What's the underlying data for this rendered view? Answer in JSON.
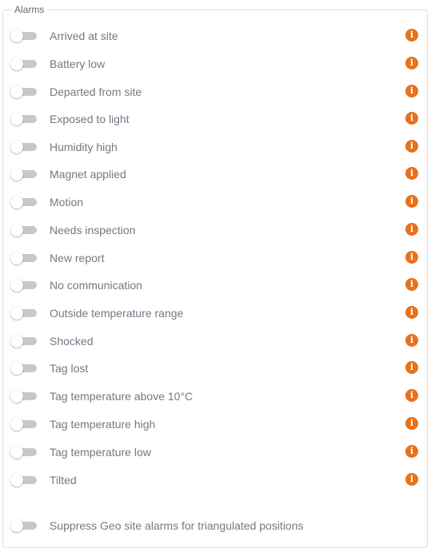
{
  "alarms": {
    "legend": "Alarms",
    "accent_color": "#e8711c",
    "toggle_state_default": "off",
    "info_icon": "info-circle-icon",
    "items": [
      {
        "label": "Arrived at site",
        "enabled": false
      },
      {
        "label": "Battery low",
        "enabled": false
      },
      {
        "label": "Departed from site",
        "enabled": false
      },
      {
        "label": "Exposed to light",
        "enabled": false
      },
      {
        "label": "Humidity high",
        "enabled": false
      },
      {
        "label": "Magnet applied",
        "enabled": false
      },
      {
        "label": "Motion",
        "enabled": false
      },
      {
        "label": "Needs inspection",
        "enabled": false
      },
      {
        "label": "New report",
        "enabled": false
      },
      {
        "label": "No communication",
        "enabled": false
      },
      {
        "label": "Outside temperature range",
        "enabled": false
      },
      {
        "label": "Shocked",
        "enabled": false
      },
      {
        "label": "Tag lost",
        "enabled": false
      },
      {
        "label": "Tag temperature above 10°C",
        "enabled": false
      },
      {
        "label": "Tag temperature high",
        "enabled": false
      },
      {
        "label": "Tag temperature low",
        "enabled": false
      },
      {
        "label": "Tilted",
        "enabled": false
      }
    ],
    "suppress": {
      "label": "Suppress Geo site alarms for triangulated positions",
      "enabled": false
    }
  }
}
